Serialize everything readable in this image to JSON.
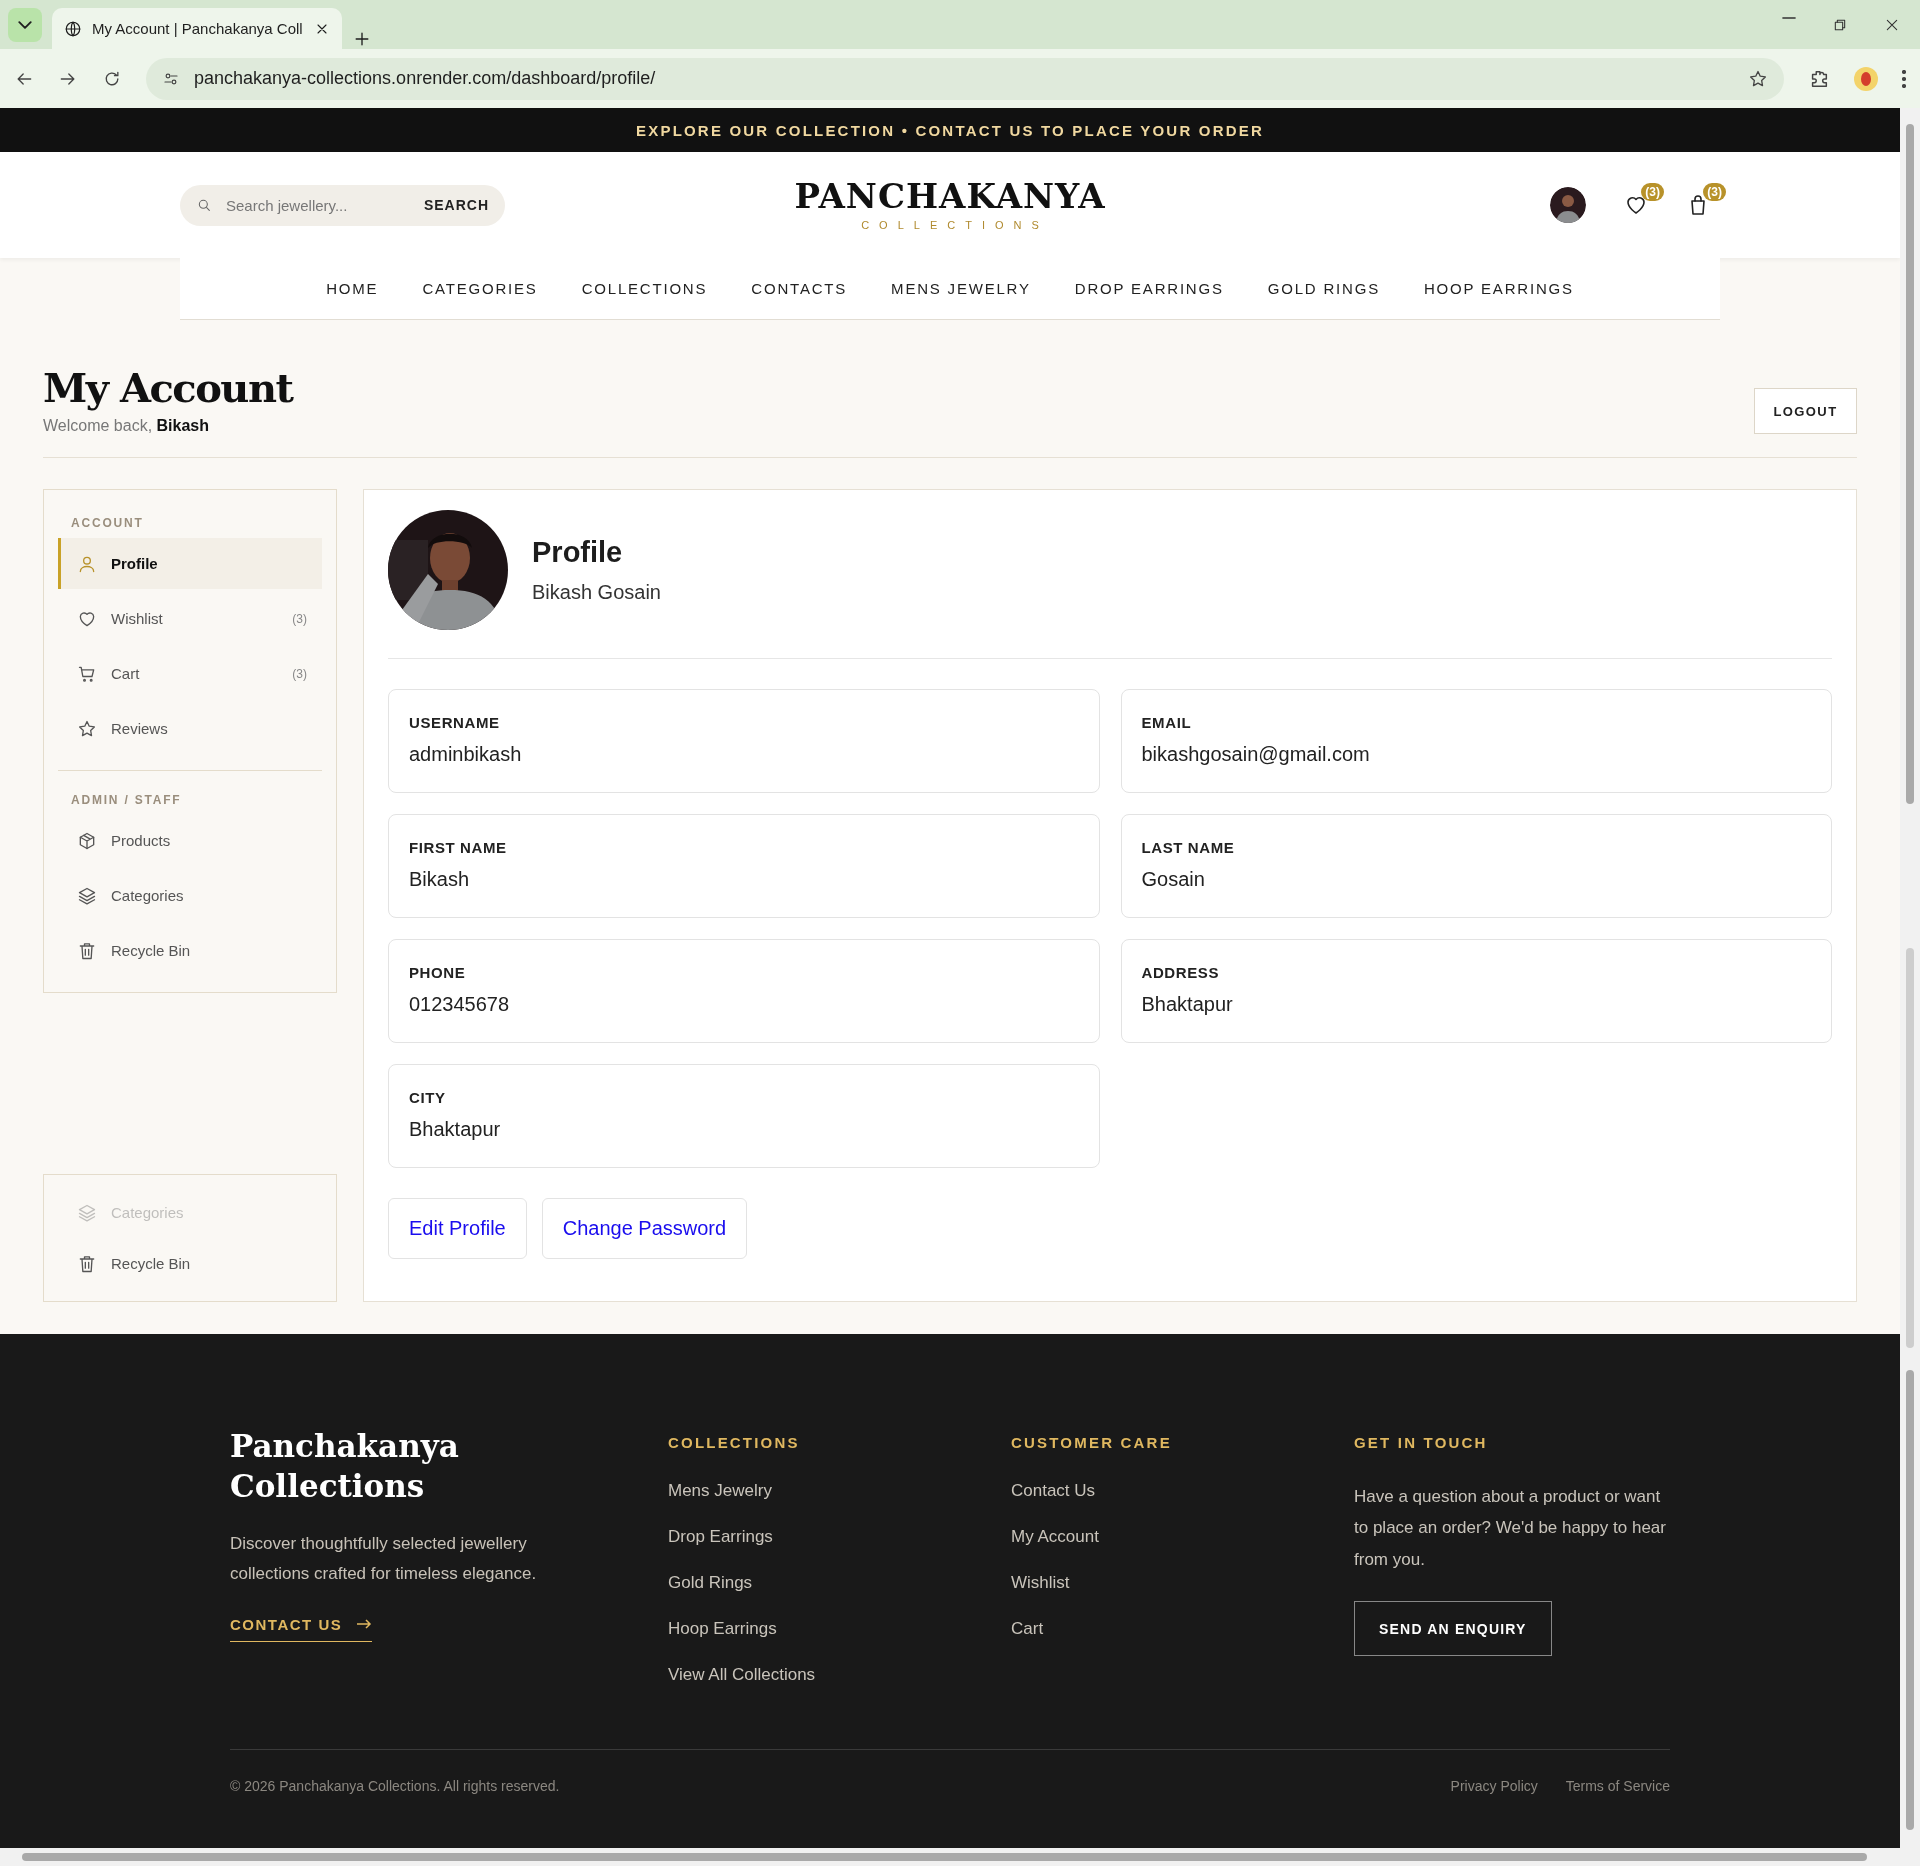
{
  "browser": {
    "tab_title": "My Account | Panchakanya Coll",
    "url": "panchakanya-collections.onrender.com/dashboard/profile/"
  },
  "announcement": "EXPLORE OUR COLLECTION • CONTACT US TO PLACE YOUR ORDER",
  "header": {
    "search": {
      "placeholder": "Search jewellery...",
      "button": "SEARCH"
    },
    "logo": {
      "name": "PANCHAKANYA",
      "tagline": "COLLECTIONS"
    },
    "wishlist_count": "(3)",
    "cart_count": "(3)"
  },
  "nav": [
    "HOME",
    "CATEGORIES",
    "COLLECTIONS",
    "CONTACTS",
    "MENS JEWELRY",
    "DROP EARRINGS",
    "GOLD RINGS",
    "HOOP EARRINGS"
  ],
  "page": {
    "title": "My Account",
    "welcome": "Welcome back,",
    "user_name": "Bikash",
    "logout": "LOGOUT"
  },
  "sidebar": [
    {
      "heading": "ACCOUNT",
      "items": [
        {
          "label": "Profile",
          "kind": "user",
          "selected": true
        },
        {
          "label": "Wishlist",
          "kind": "heart",
          "count": "(3)",
          "selected": false
        },
        {
          "label": "Cart",
          "kind": "cart",
          "count": "(3)",
          "selected": false
        },
        {
          "label": "Reviews",
          "kind": "star",
          "selected": false
        }
      ]
    },
    {
      "heading": "ADMIN / STAFF",
      "items": [
        {
          "label": "Products",
          "kind": "box",
          "selected": false
        },
        {
          "label": "Categories",
          "kind": "layers",
          "selected": false
        },
        {
          "label": "Recycle Bin",
          "kind": "trash",
          "selected": false
        }
      ]
    }
  ],
  "sidebar_lower": [
    {
      "label": "Categories",
      "kind": "layers",
      "faded": true
    },
    {
      "label": "Recycle Bin",
      "kind": "trash",
      "faded": false
    }
  ],
  "profile": {
    "heading": "Profile",
    "full_name": "Bikash Gosain",
    "fields": [
      {
        "label": "USERNAME",
        "value": "adminbikash"
      },
      {
        "label": "EMAIL",
        "value": "bikashgosain@gmail.com"
      },
      {
        "label": "FIRST NAME",
        "value": "Bikash"
      },
      {
        "label": "LAST NAME",
        "value": "Gosain"
      },
      {
        "label": "PHONE",
        "value": "012345678"
      },
      {
        "label": "ADDRESS",
        "value": "Bhaktapur"
      },
      {
        "label": "CITY",
        "value": "Bhaktapur"
      }
    ],
    "buttons": [
      "Edit Profile",
      "Change Password"
    ]
  },
  "footer": {
    "brand": "Panchakanya Collections",
    "description": "Discover thoughtfully selected jewellery collections crafted for timeless elegance.",
    "contact_link": "CONTACT US",
    "columns": [
      {
        "heading": "COLLECTIONS",
        "links": [
          "Mens Jewelry",
          "Drop Earrings",
          "Gold Rings",
          "Hoop Earrings",
          "View All Collections"
        ]
      },
      {
        "heading": "CUSTOMER CARE",
        "links": [
          "Contact Us",
          "My Account",
          "Wishlist",
          "Cart"
        ]
      }
    ],
    "get_in_touch": {
      "heading": "GET IN TOUCH",
      "text": "Have a question about a product or want to place an order? We'd be happy to hear from you.",
      "button": "SEND AN ENQUIRY"
    },
    "copyright": "© 2026 Panchakanya Collections. All rights reserved.",
    "legal_links": [
      "Privacy Policy",
      "Terms of Service"
    ]
  }
}
